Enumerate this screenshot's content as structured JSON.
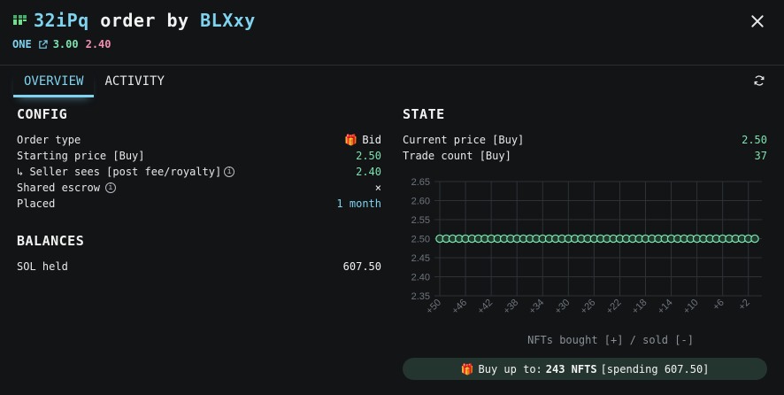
{
  "header": {
    "name": "32iPq",
    "mid": "order by",
    "owner": "BLXxy",
    "collection": "ONE",
    "buy_price": "3.00",
    "sell_price": "2.40"
  },
  "tabs": [
    {
      "label": "OVERVIEW",
      "active": true
    },
    {
      "label": "ACTIVITY",
      "active": false
    }
  ],
  "config": {
    "title": "CONFIG",
    "rows": {
      "order_type": {
        "label": "Order type",
        "value": "Bid"
      },
      "starting_price": {
        "label": "Starting price [Buy]",
        "value": "2.50"
      },
      "seller_sees": {
        "label": "↳ Seller sees [post fee/royalty]",
        "value": "2.40"
      },
      "shared_escrow": {
        "label": "Shared escrow",
        "value": "×"
      },
      "placed": {
        "label": "Placed",
        "value": "1 month"
      }
    }
  },
  "balances": {
    "title": "BALANCES",
    "sol_held": {
      "label": "SOL held",
      "value": "607.50"
    }
  },
  "state": {
    "title": "STATE",
    "current_price": {
      "label": "Current price [Buy]",
      "value": "2.50"
    },
    "trade_count": {
      "label": "Trade count [Buy]",
      "value": "37"
    }
  },
  "chart_data": {
    "type": "line",
    "xlabel": "NFTs bought [+] / sold [-]",
    "ylabel": "",
    "ylim": [
      2.35,
      2.65
    ],
    "yticks": [
      "2.65",
      "2.60",
      "2.55",
      "2.50",
      "2.45",
      "2.40",
      "2.35"
    ],
    "xtick_labels": [
      "+50",
      "+46",
      "+42",
      "+38",
      "+34",
      "+30",
      "+26",
      "+22",
      "+18",
      "+14",
      "+10",
      "+6",
      "+2"
    ],
    "x": [
      50,
      49,
      48,
      47,
      46,
      45,
      44,
      43,
      42,
      41,
      40,
      39,
      38,
      37,
      36,
      35,
      34,
      33,
      32,
      31,
      30,
      29,
      28,
      27,
      26,
      25,
      24,
      23,
      22,
      21,
      20,
      19,
      18,
      17,
      16,
      15,
      14,
      13,
      12,
      11,
      10,
      9,
      8,
      7,
      6,
      5,
      4,
      3,
      2,
      1
    ],
    "values": [
      2.5,
      2.5,
      2.5,
      2.5,
      2.5,
      2.5,
      2.5,
      2.5,
      2.5,
      2.5,
      2.5,
      2.5,
      2.5,
      2.5,
      2.5,
      2.5,
      2.5,
      2.5,
      2.5,
      2.5,
      2.5,
      2.5,
      2.5,
      2.5,
      2.5,
      2.5,
      2.5,
      2.5,
      2.5,
      2.5,
      2.5,
      2.5,
      2.5,
      2.5,
      2.5,
      2.5,
      2.5,
      2.5,
      2.5,
      2.5,
      2.5,
      2.5,
      2.5,
      2.5,
      2.5,
      2.5,
      2.5,
      2.5,
      2.5,
      2.5
    ],
    "grid": true,
    "line_color": "#7ee3b0"
  },
  "buy_pill": {
    "prefix": "Buy up to:",
    "amount": "243 NFTS",
    "spending": "[spending 607.50]"
  },
  "colors": {
    "accent": "#7fd3ee",
    "green": "#7ee3b0",
    "pink": "#f08fb0",
    "background": "#121416"
  }
}
